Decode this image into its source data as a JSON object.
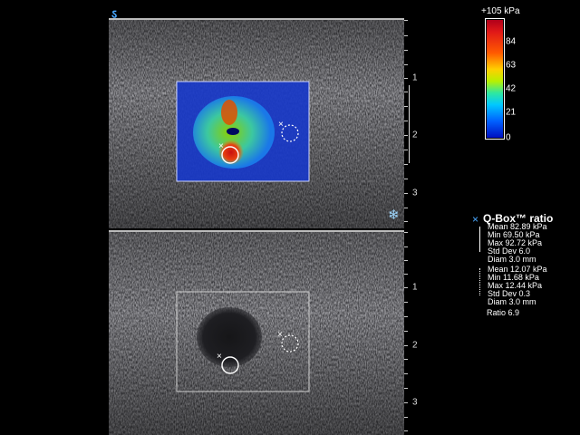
{
  "probe_icon": "probe-orientation-icon",
  "freeze_icon": "snowflake-icon",
  "colorbar": {
    "max_label": "+105 kPa",
    "labels": [
      "84",
      "63",
      "42",
      "21",
      "0"
    ],
    "top_color": "#b0001a",
    "bottom_color": "#0010c0"
  },
  "depth_top": {
    "labels": [
      "1",
      "2",
      "3"
    ]
  },
  "depth_bottom": {
    "labels": [
      "1",
      "2",
      "3"
    ]
  },
  "qbox": {
    "title": "Q-Box™ ratio",
    "marker": "×",
    "roi1": {
      "mean": "Mean 82.89 kPa",
      "min": "Min 69.50 kPa",
      "max": "Max 92.72 kPa",
      "std": "Std Dev 6.0",
      "diam": "Diam 3.0 mm"
    },
    "roi2": {
      "mean": "Mean 12.07 kPa",
      "min": "Min 11.68 kPa",
      "max": "Max 12.44 kPa",
      "std": "Std Dev 0.3",
      "diam": "Diam 3.0 mm"
    },
    "ratio": "Ratio 6.9"
  }
}
